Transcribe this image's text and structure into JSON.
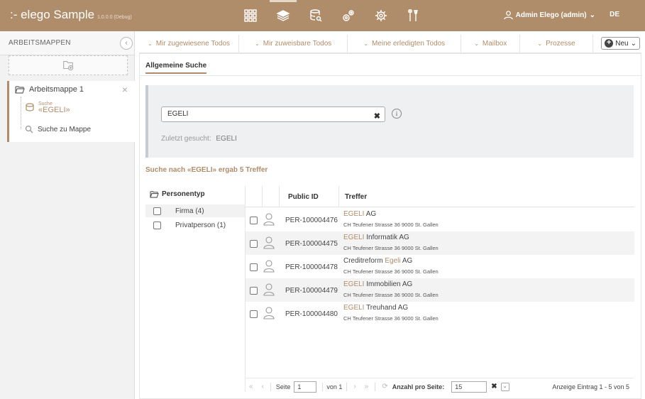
{
  "app": {
    "title": ":- elego Sample",
    "version": "1.0.0.0 (Debug)",
    "user": "Admin Elego (admin)",
    "lang": "DE",
    "accent": "#b08d6a",
    "nav_icons": [
      "grid-icon",
      "layers-icon",
      "database-search-icon",
      "gears-icon",
      "gear-icon",
      "tools-icon"
    ]
  },
  "sidebar": {
    "header": "ARBEITSMAPPEN",
    "collapse_icon": "chevron-left-icon",
    "mappe": "Arbeitsmappe 1",
    "suche_small": "Suche",
    "suche_value": "«EGELI»",
    "suche_zu_mappe": "Suche zu Mappe"
  },
  "tabs": [
    {
      "label": "Mir zugewiesene Todos"
    },
    {
      "label": "Mir zuweisbare Todos"
    },
    {
      "label": "Meine erledigten Todos"
    },
    {
      "label": "Mailbox"
    },
    {
      "label": "Prozesse"
    }
  ],
  "new_button": "Neu",
  "content": {
    "tab": "Allgemeine Suche",
    "search_value": "EGELI",
    "last_label": "Zuletzt gesucht:",
    "last_value": "EGELI",
    "result_text": "Suche nach «EGELI» ergab 5 Treffer"
  },
  "facets": {
    "title": "Personentyp",
    "items": [
      {
        "label": "Firma (4)"
      },
      {
        "label": "Privatperson (1)"
      }
    ]
  },
  "table": {
    "headers": {
      "public_id": "Public ID",
      "treffer": "Treffer"
    },
    "rows": [
      {
        "id": "PER-100004476",
        "pre": "",
        "hl": "EGELI",
        "post": " AG",
        "addr": "CH Teufener Strasse 36 9000 St. Gallen"
      },
      {
        "id": "PER-100004475",
        "pre": "",
        "hl": "EGELI",
        "post": " Informatik AG",
        "addr": "CH Teufener Strasse 36 9000 St. Gallen"
      },
      {
        "id": "PER-100004478",
        "pre": "Creditreform ",
        "hl": "Egeli",
        "post": " AG",
        "addr": "CH Teufener Strasse 36 9000 St. Gallen"
      },
      {
        "id": "PER-100004479",
        "pre": "",
        "hl": "EGELI",
        "post": " Immobilien AG",
        "addr": "CH Teufener Strasse 36 9000 St. Gallen"
      },
      {
        "id": "PER-100004480",
        "pre": "",
        "hl": "EGELI",
        "post": " Treuhand AG",
        "addr": "CH Teufener Strasse 36 9000 St. Gallen"
      }
    ]
  },
  "pager": {
    "seite": "Seite",
    "page": "1",
    "von": "von 1",
    "anzahl": "Anzahl pro Seite:",
    "size": "15",
    "info": "Anzeige Eintrag 1 - 5 von 5"
  }
}
